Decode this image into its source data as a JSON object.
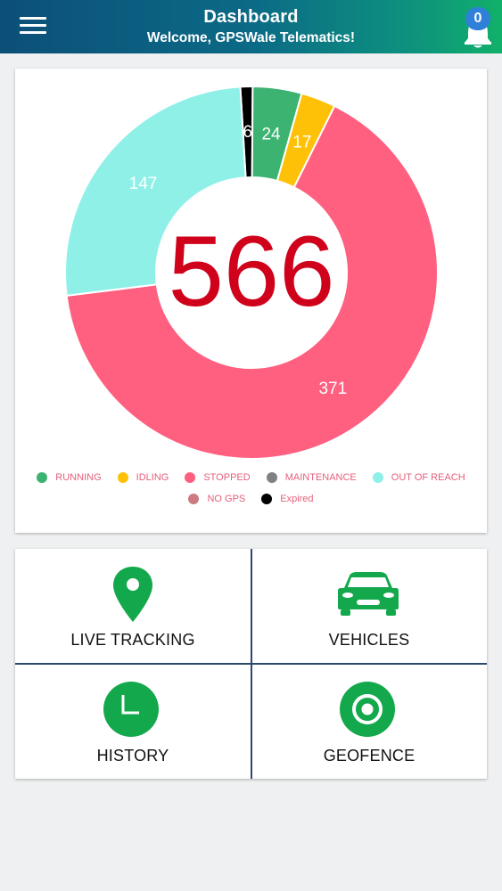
{
  "header": {
    "title": "Dashboard",
    "subtitle": "Welcome, GPSWale Telematics!",
    "notification_count": "0",
    "menu_icon": "hamburger-menu-icon",
    "bell_icon": "bell-icon"
  },
  "chart_data": {
    "type": "pie",
    "subtype": "donut",
    "total": "566",
    "segments": [
      {
        "name": "RUNNING",
        "value": 24,
        "color": "#3cb371"
      },
      {
        "name": "IDLING",
        "value": 17,
        "color": "#ffc107"
      },
      {
        "name": "STOPPED",
        "value": 371,
        "color": "#ff6080"
      },
      {
        "name": "MAINTENANCE",
        "value": 0,
        "color": "#808080"
      },
      {
        "name": "OUT OF REACH",
        "value": 147,
        "color": "#8ff0e8"
      },
      {
        "name": "NO GPS",
        "value": 0,
        "color": "#cd7a80"
      },
      {
        "name": "Expired",
        "value": 6,
        "color": "#000000"
      }
    ],
    "legend_placement": "bottom",
    "legend_rows": [
      [
        "RUNNING",
        "IDLING",
        "STOPPED",
        "MAINTENANCE",
        "OUT OF REACH"
      ],
      [
        "NO GPS",
        "Expired"
      ]
    ]
  },
  "menu": {
    "tiles": [
      {
        "label": "LIVE TRACKING",
        "icon": "map-pin-icon"
      },
      {
        "label": "VEHICLES",
        "icon": "car-icon"
      },
      {
        "label": "HISTORY",
        "icon": "clock-icon"
      },
      {
        "label": "GEOFENCE",
        "icon": "target-icon"
      }
    ],
    "icon_color": "#13a84c"
  }
}
